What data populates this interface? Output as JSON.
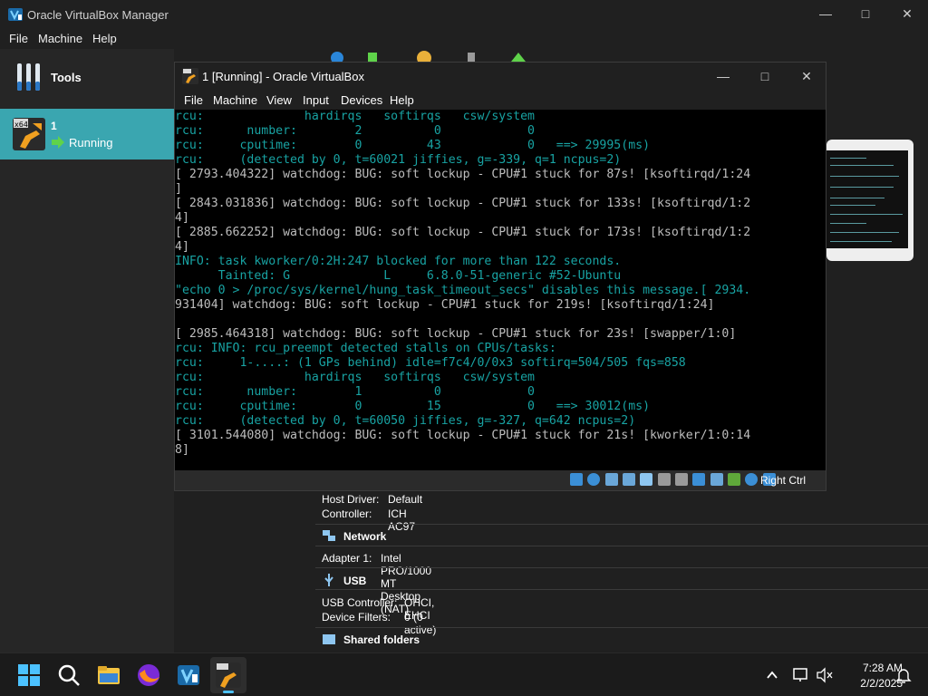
{
  "manager": {
    "title": "Oracle VirtualBox Manager",
    "menu": [
      "File",
      "Machine",
      "Help"
    ],
    "tools_label": "Tools",
    "vm_name": "1",
    "vm_state": "Running",
    "details": {
      "host_driver_key": "Host Driver:",
      "host_driver_val": "Default",
      "controller_key": "Controller:",
      "controller_val": "ICH AC97",
      "network_title": "Network",
      "adapter_key": "Adapter 1:",
      "adapter_val": "Intel PRO/1000 MT Desktop (NAT)",
      "usb_title": "USB",
      "usb_controller_key": "USB Controller:",
      "usb_controller_val": "OHCI, EHCI",
      "device_filters_key": "Device Filters:",
      "device_filters_val": "0 (0 active)",
      "shared_folders_title": "Shared folders"
    }
  },
  "vm_window": {
    "title": "1 [Running] - Oracle VirtualBox",
    "menu": [
      "File",
      "Machine",
      "View",
      "Input",
      "Devices",
      "Help"
    ],
    "host_key": "Right Ctrl",
    "console_lines": [
      {
        "text": "rcu:              hardirqs   softirqs   csw/system",
        "style": "cyan"
      },
      {
        "text": "rcu:      number:        2          0            0",
        "style": "cyan"
      },
      {
        "text": "rcu:     cputime:        0         43            0   ==> 29995(ms)",
        "style": "cyan"
      },
      {
        "text": "rcu:     (detected by 0, t=60021 jiffies, g=-339, q=1 ncpus=2)",
        "style": "cyan"
      },
      {
        "text": "[ 2793.404322] watchdog: BUG: soft lockup - CPU#1 stuck for 87s! [ksoftirqd/1:24",
        "style": "white"
      },
      {
        "text": "]",
        "style": "white"
      },
      {
        "text": "[ 2843.031836] watchdog: BUG: soft lockup - CPU#1 stuck for 133s! [ksoftirqd/1:2",
        "style": "white"
      },
      {
        "text": "4]",
        "style": "white"
      },
      {
        "text": "[ 2885.662252] watchdog: BUG: soft lockup - CPU#1 stuck for 173s! [ksoftirqd/1:2",
        "style": "white"
      },
      {
        "text": "4]",
        "style": "white"
      },
      {
        "text": "INFO: task kworker/0:2H:247 blocked for more than 122 seconds.",
        "style": "cyan"
      },
      {
        "text": "      Tainted: G             L     6.8.0-51-generic #52-Ubuntu",
        "style": "cyan"
      },
      {
        "text": "\"echo 0 > /proc/sys/kernel/hung_task_timeout_secs\" disables this message.[ 2934.",
        "style": "cyan"
      },
      {
        "text": "931404] watchdog: BUG: soft lockup - CPU#1 stuck for 219s! [ksoftirqd/1:24]",
        "style": "white"
      },
      {
        "text": "",
        "style": "white"
      },
      {
        "text": "[ 2985.464318] watchdog: BUG: soft lockup - CPU#1 stuck for 23s! [swapper/1:0]",
        "style": "white"
      },
      {
        "text": "rcu: INFO: rcu_preempt detected stalls on CPUs/tasks:",
        "style": "cyan"
      },
      {
        "text": "rcu:     1-....: (1 GPs behind) idle=f7c4/0/0x3 softirq=504/505 fqs=858",
        "style": "cyan"
      },
      {
        "text": "rcu:              hardirqs   softirqs   csw/system",
        "style": "cyan"
      },
      {
        "text": "rcu:      number:        1          0            0",
        "style": "cyan"
      },
      {
        "text": "rcu:     cputime:        0         15            0   ==> 30012(ms)",
        "style": "cyan"
      },
      {
        "text": "rcu:     (detected by 0, t=60050 jiffies, g=-327, q=642 ncpus=2)",
        "style": "cyan"
      },
      {
        "text": "[ 3101.544080] watchdog: BUG: soft lockup - CPU#1 stuck for 21s! [kworker/1:0:14",
        "style": "white"
      },
      {
        "text": "8]",
        "style": "white"
      },
      {
        "text": "",
        "style": "white"
      },
      {
        "text": "_",
        "style": "white"
      }
    ]
  },
  "taskbar": {
    "time": "7:28 AM",
    "date": "2/2/2025"
  },
  "colors": {
    "accent_selected": "#3aa6b0",
    "console_cyan": "#18a3a3",
    "console_text": "#bdbdbd"
  }
}
